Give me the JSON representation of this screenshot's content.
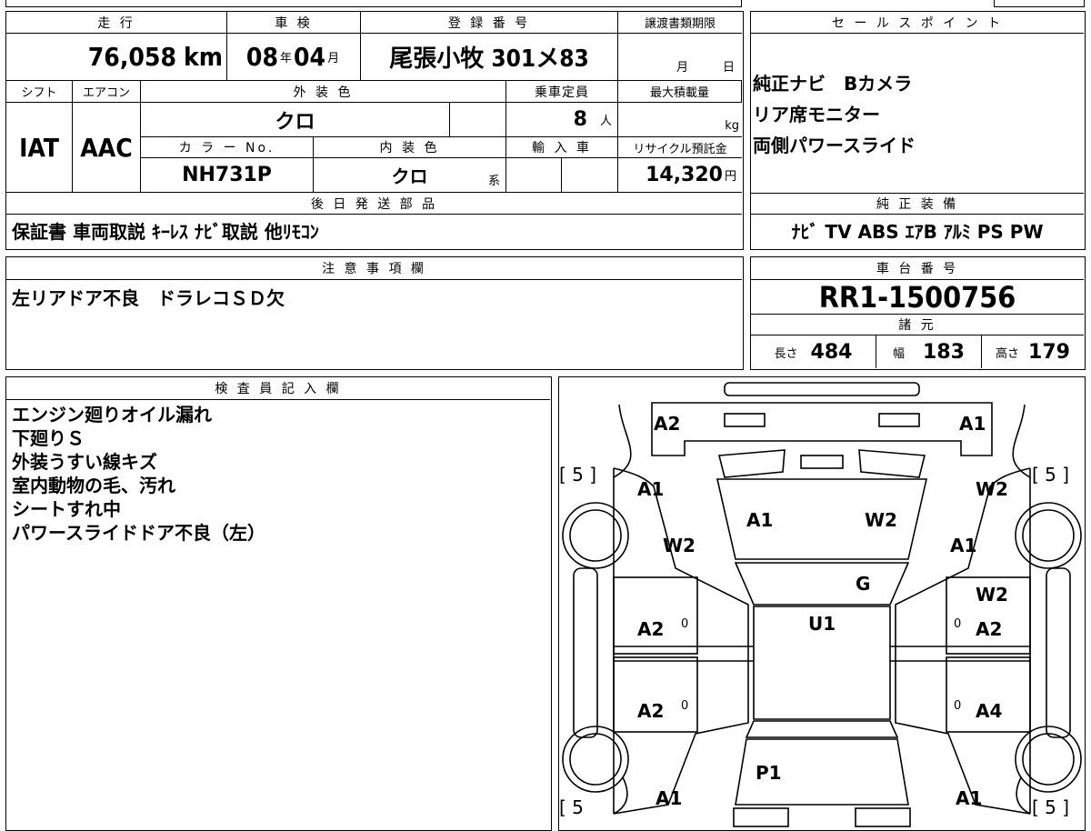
{
  "vehicle": {
    "mileage_label": "走 行",
    "mileage_value": "76,058",
    "mileage_unit": "km",
    "shaken_label": "車 検",
    "shaken_year": "08",
    "shaken_year_unit": "年",
    "shaken_month": "04",
    "shaken_month_unit": "月",
    "registration_label": "登 録 番 号",
    "registration_value": "尾張小牧 301メ83",
    "transfer_label": "譲渡書類期限",
    "transfer_month_unit": "月",
    "transfer_day_unit": "日",
    "shift_label": "シフト",
    "shift_value": "IAT",
    "aircon_label": "エアコン",
    "aircon_value": "AAC",
    "exterior_label": "外 装 色",
    "exterior_value": "クロ",
    "capacity_label": "乗車定員",
    "capacity_value": "8",
    "capacity_unit": "人",
    "load_label": "最大積載量",
    "load_unit": "kg",
    "color_no_label": "カ ラ ー No.",
    "color_no_value": "NH731P",
    "interior_label": "内 装 色",
    "interior_value": "クロ",
    "interior_unit": "系",
    "import_label": "輸 入 車",
    "recycle_label": "リサイクル預託金",
    "recycle_value": "14,320",
    "recycle_unit": "円"
  },
  "later_parts": {
    "label": "後 日 発 送 部 品",
    "value": "保証書 車両取説 ｷｰﾚｽ ﾅﾋﾞ取説 他ﾘﾓｺﾝ"
  },
  "sales_points": {
    "label": "セ ー ル ス ポ イ ン ト",
    "lines": [
      "純正ナビ　Bカメラ",
      "リア席モニター",
      "両側パワースライド"
    ]
  },
  "equipment": {
    "label": "純 正 装 備",
    "value": "ﾅﾋﾞ TV ABS ｴｱB ｱﾙﾐ PS PW"
  },
  "notes": {
    "label": "注 意 事 項 欄",
    "value": "左リアドア不良　ドラレコＳＤ欠"
  },
  "chassis": {
    "label": "車 台 番 号",
    "value": "RR1-1500756",
    "specs_label": "諸 元",
    "length_label": "長さ",
    "length_value": "484",
    "width_label": "幅",
    "width_value": "183",
    "height_label": "高さ",
    "height_value": "179"
  },
  "inspector": {
    "label": "検 査 員 記 入 欄",
    "lines": [
      "エンジン廻りオイル漏れ",
      "下廻りＳ",
      "外装うすい線キズ",
      "室内動物の毛、汚れ",
      "シートすれ中",
      "パワースライドドア不良（左）"
    ]
  },
  "diagram": {
    "tire_left_top": "[ 5 ]",
    "tire_right_top": "[ 5 ]",
    "tire_left_bottom": "[ 5",
    "tire_right_bottom": "[ 5 ]",
    "front_bumper_left": "A2",
    "front_bumper_right": "A1",
    "hood_left": "A1",
    "hood_right": "W2",
    "front_fender_left_a": "A1",
    "front_fender_left_b": "W2",
    "front_fender_right_a": "W2",
    "front_fender_right_b": "A1",
    "windshield": "G",
    "roof": "U1",
    "right_front_door_a": "W2",
    "right_front_door_b": "A2",
    "left_front_door": "A2",
    "left_rear_door": "A2",
    "right_rear_door": "A4",
    "left_rear_door_mark": "0",
    "left_front_door_mark": "0",
    "right_front_door_mark": "0",
    "right_rear_door_mark": "0",
    "tailgate": "P1",
    "rear_left": "A1",
    "rear_right": "A1"
  }
}
